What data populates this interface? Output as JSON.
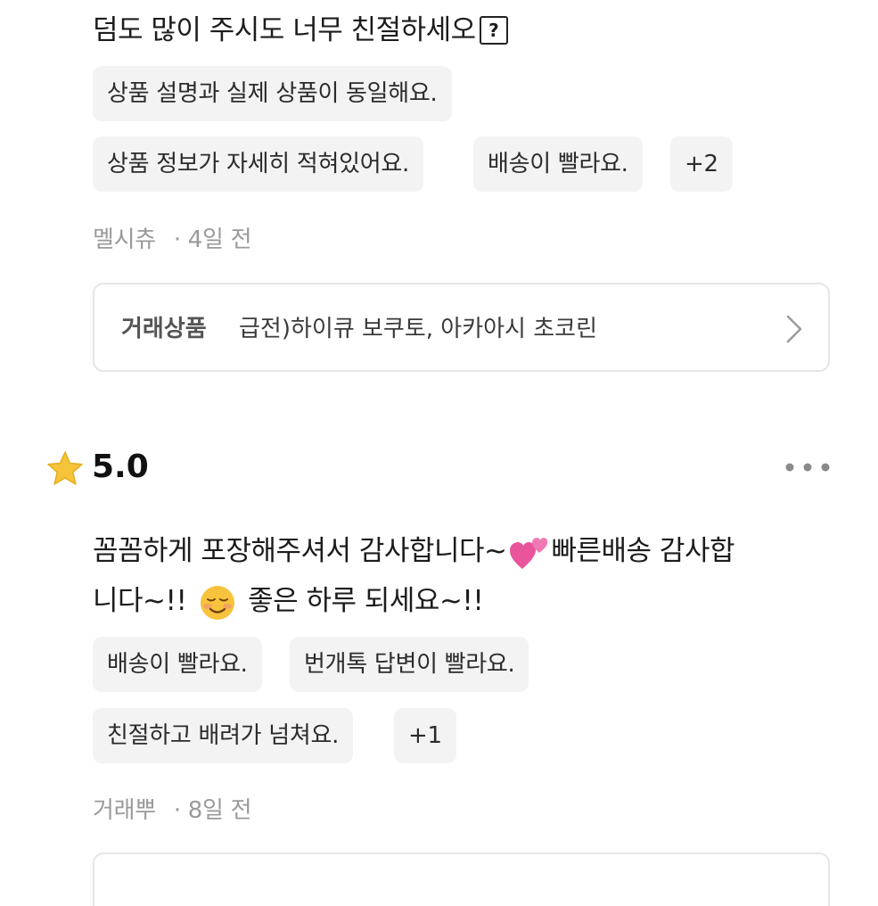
{
  "review1": {
    "text": "덤도 많이 주시도 너무 친절하세오",
    "text_symbol": "?",
    "chips": [
      "상품 설명과 실제 상품이 동일해요.",
      "상품 정보가 자세히 적혀있어요.",
      "배송이 빨라요.",
      "+2"
    ],
    "author": "멜시츄",
    "time": "· 4일 전",
    "product_label": "거래상품",
    "product_name": "급전)하이큐 보쿠토, 아카아시 초코린"
  },
  "review2": {
    "rating": "5.0",
    "text_line1_a": "꼼꼼하게 포장해주셔서 감사합니다~",
    "text_line1_b": "빠른배송 감사합",
    "text_line2_a": "니다~!!",
    "text_line2_b": "좋은 하루 되세요~!!",
    "chips": [
      "배송이 빨라요.",
      "번개톡 답변이 빨라요.",
      "친절하고 배려가 넘쳐요.",
      "+1"
    ],
    "author": "거래뿌",
    "time": "· 8일 전"
  },
  "icons": {
    "star": "star-icon",
    "more": "more-options-icon",
    "chevron": "chevron-right-icon",
    "hearts": "two-hearts-emoji",
    "smile": "smiling-face-emoji"
  },
  "colors": {
    "chip_bg": "#f3f3f4",
    "meta_text": "#9a9a9a",
    "star": "#f5c43a",
    "heart": "#e8559a"
  }
}
